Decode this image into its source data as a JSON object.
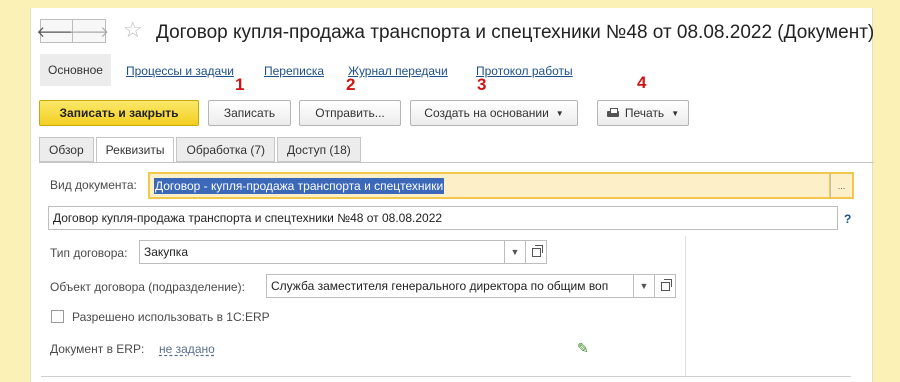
{
  "title": "Договор купля-продажа транспорта и спецтехники №48 от 08.08.2022 (Документ)",
  "nav": {
    "back": "🡐",
    "forward": "🡒",
    "star": "☆"
  },
  "sections": {
    "active": "Основное",
    "links": [
      "Процессы и задачи",
      "Переписка",
      "Журнал передачи",
      "Протокол работы"
    ]
  },
  "annotations": [
    "1",
    "2",
    "3",
    "4"
  ],
  "toolbar": {
    "save_close": "Записать и закрыть",
    "save": "Записать",
    "send": "Отправить...",
    "create_based": "Создать на основании",
    "print": "Печать"
  },
  "tabs": [
    "Обзор",
    "Реквизиты",
    "Обработка (7)",
    "Доступ (18)"
  ],
  "form": {
    "doc_kind_label": "Вид документа:",
    "doc_kind_value": "Договор - купля-продажа транспорта и спецтехники",
    "doc_kind_btn": "...",
    "doc_title_value": "Договор купля-продажа транспорта и спецтехники №48 от 08.08.2022",
    "help": "?",
    "contract_type_label": "Тип договора:",
    "contract_type_value": "Закупка",
    "contract_object_label": "Объект договора (подразделение):",
    "contract_object_value": "Служба заместителя генерального директора по общим воп",
    "erp_allowed_label": "Разрешено использовать в 1С:ERP",
    "erp_doc_label": "Документ в ERP:",
    "erp_doc_value": "не задано"
  },
  "colors": {
    "accent": "#f3cf20",
    "link": "#1c4f8c",
    "annotation": "#d01414",
    "background": "#fbf0b6"
  }
}
